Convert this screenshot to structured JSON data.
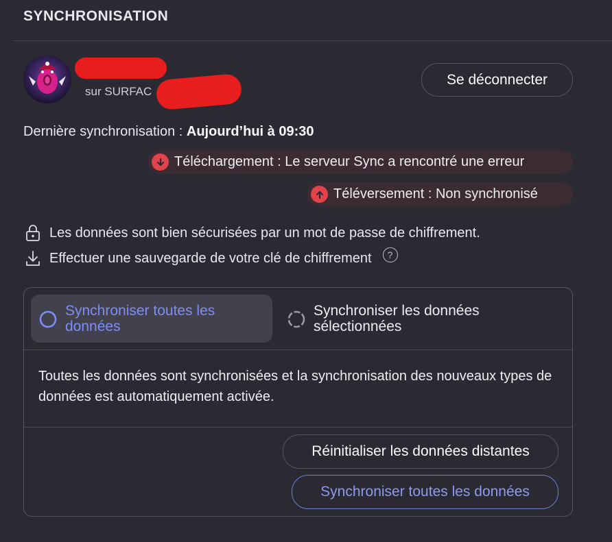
{
  "section": {
    "title": "SYNCHRONISATION"
  },
  "account": {
    "device_prefix": "sur SURFAC",
    "signout_label": "Se déconnecter"
  },
  "last_sync": {
    "label": "Dernière synchronisation : ",
    "value": "Aujourd’hui à 09:30"
  },
  "status": {
    "download_text": "Téléchargement : Le serveur Sync a rencontré une erreur",
    "download_icon": "arrow-down-circle-icon",
    "upload_text": "Téléversement : Non synchronisé",
    "upload_icon": "arrow-up-circle-icon",
    "error_color": "#e2434b"
  },
  "info": {
    "encryption_text": "Les données sont bien sécurisées par un mot de passe de chiffrement.",
    "backup_text": "Effectuer une sauvegarde de votre clé de chiffrement",
    "help_symbol": "?"
  },
  "sync_options": {
    "all_label": "Synchroniser toutes les données",
    "selected_label": "Synchroniser les données sélectionnées",
    "active": "all",
    "description": "Toutes les données sont synchronisées et la synchronisation des nouveaux types de données est automatiquement activée."
  },
  "actions": {
    "reset_label": "Réinitialiser les données distantes",
    "sync_all_label": "Synchroniser toutes les données"
  },
  "colors": {
    "background": "#2b2a33",
    "accent": "#7b8ff7",
    "redaction": "#e81d1d"
  }
}
